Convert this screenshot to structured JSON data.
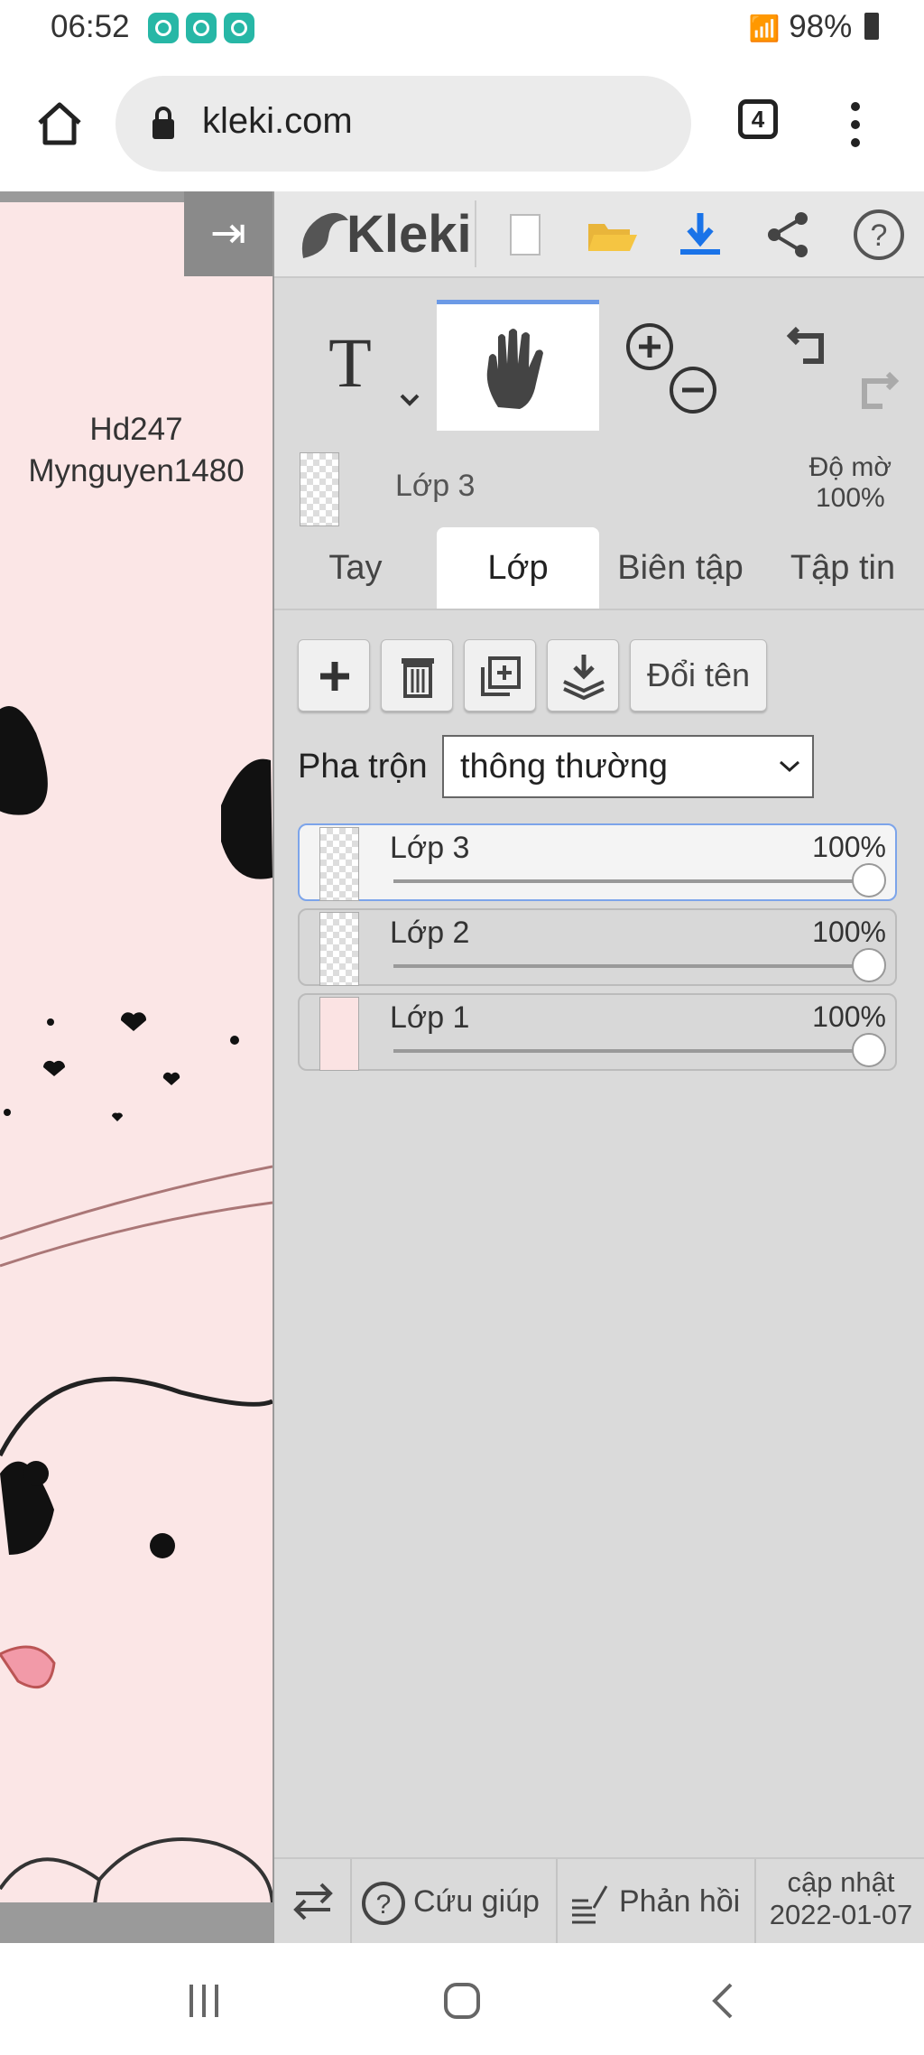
{
  "status": {
    "time": "06:52",
    "battery": "98%"
  },
  "browser": {
    "url": "kleki.com",
    "tab_count": "4"
  },
  "canvas": {
    "line1": "Hd247",
    "line2": "Mynguyen1480"
  },
  "app": {
    "logo_text": "Kleki"
  },
  "layer_info": {
    "name": "Lớp 3",
    "opacity_label": "Độ mờ",
    "opacity_value": "100%"
  },
  "tabs": [
    {
      "label": "Tay"
    },
    {
      "label": "Lớp"
    },
    {
      "label": "Biên tập"
    },
    {
      "label": "Tập tin"
    }
  ],
  "actions": {
    "rename_label": "Đổi tên"
  },
  "blend": {
    "label": "Pha trộn",
    "value": "thông thường"
  },
  "layers": [
    {
      "name": "Lớp 3",
      "opacity": "100%"
    },
    {
      "name": "Lớp 2",
      "opacity": "100%"
    },
    {
      "name": "Lớp 1",
      "opacity": "100%"
    }
  ],
  "footer": {
    "help_label": "Cứu giúp",
    "feedback_label": "Phản hồi",
    "update_label": "cập nhật",
    "update_date": "2022-01-07"
  },
  "colors": {
    "accent": "#6c9ae6",
    "download_blue": "#1a73e8",
    "folder_yellow": "#f5c542"
  }
}
